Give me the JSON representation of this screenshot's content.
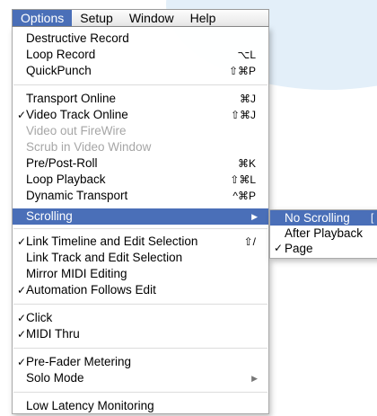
{
  "menubar": {
    "items": [
      {
        "label": "Options",
        "active": true
      },
      {
        "label": "Setup"
      },
      {
        "label": "Window"
      },
      {
        "label": "Help"
      }
    ]
  },
  "menu": {
    "items": [
      {
        "label": "Destructive Record",
        "check": "",
        "shortcut": ""
      },
      {
        "label": "Loop Record",
        "check": "",
        "shortcut": "⌥L"
      },
      {
        "label": "QuickPunch",
        "check": "",
        "shortcut": "⇧⌘P"
      },
      {
        "label": "Transport Online",
        "check": "",
        "shortcut": "⌘J"
      },
      {
        "label": "Video Track Online",
        "check": "✓",
        "shortcut": "⇧⌘J"
      },
      {
        "label": "Video out FireWire",
        "check": "",
        "shortcut": "",
        "disabled": true
      },
      {
        "label": "Scrub in Video Window",
        "check": "",
        "shortcut": "",
        "disabled": true
      },
      {
        "label": "Pre/Post-Roll",
        "check": "",
        "shortcut": "⌘K"
      },
      {
        "label": "Loop Playback",
        "check": "",
        "shortcut": "⇧⌘L"
      },
      {
        "label": "Dynamic Transport",
        "check": "",
        "shortcut": "^⌘P"
      },
      {
        "label": "Scrolling",
        "check": "",
        "shortcut": "",
        "submenu": true,
        "highlight": true
      },
      {
        "label": "Link Timeline and Edit Selection",
        "check": "✓",
        "shortcut": "⇧/"
      },
      {
        "label": "Link Track and Edit Selection",
        "check": "",
        "shortcut": ""
      },
      {
        "label": "Mirror MIDI Editing",
        "check": "",
        "shortcut": ""
      },
      {
        "label": "Automation Follows Edit",
        "check": "✓",
        "shortcut": ""
      },
      {
        "label": "Click",
        "check": "✓",
        "shortcut": ""
      },
      {
        "label": "MIDI Thru",
        "check": "✓",
        "shortcut": ""
      },
      {
        "label": "Pre-Fader Metering",
        "check": "✓",
        "shortcut": ""
      },
      {
        "label": "Solo Mode",
        "check": "",
        "shortcut": "",
        "submenu": true
      },
      {
        "label": "Low Latency Monitoring",
        "check": "",
        "shortcut": ""
      }
    ]
  },
  "submenu": {
    "items": [
      {
        "label": "No Scrolling",
        "check": "",
        "highlight": true
      },
      {
        "label": "After Playback",
        "check": ""
      },
      {
        "label": "Page",
        "check": "✓"
      }
    ]
  },
  "colors": {
    "highlight": "#4a6fb8",
    "disabled_text": "#a6a6a6",
    "background_shape": "#e3eff9"
  },
  "icons": {
    "submenu_arrow": "triangle-right-icon",
    "checkmark": "checkmark-icon"
  }
}
